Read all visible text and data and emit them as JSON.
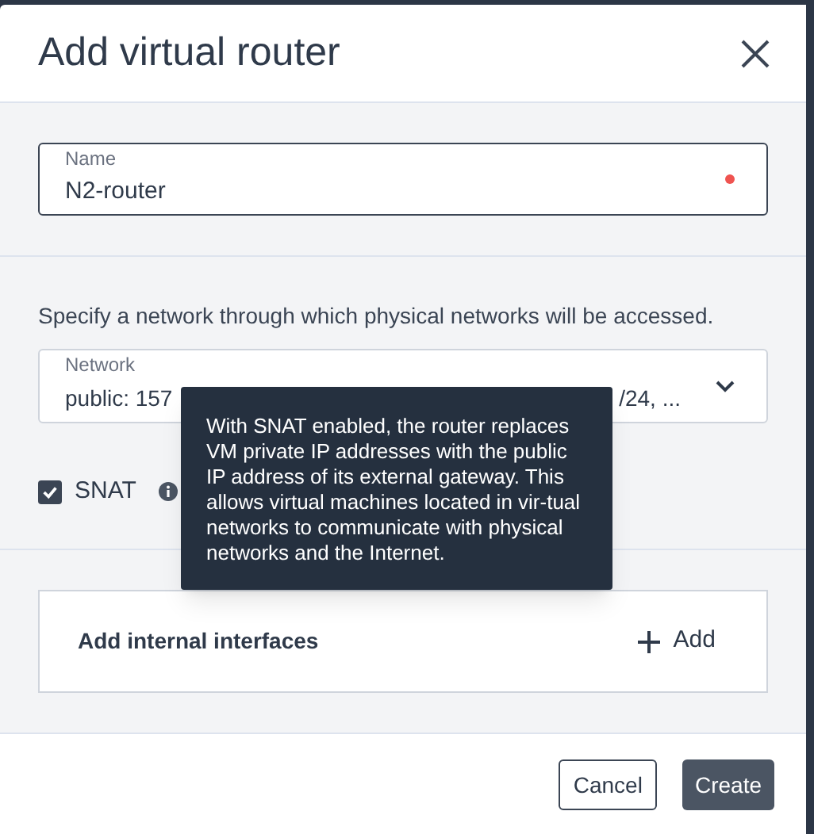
{
  "dialog": {
    "title": "Add virtual router"
  },
  "name_field": {
    "label": "Name",
    "value": "N2-router",
    "required": true
  },
  "network_section": {
    "description": "Specify a network through which physical networks will be accessed.",
    "field": {
      "label": "Network",
      "value_start": "public: 157",
      "value_end": "/24, ..."
    },
    "snat": {
      "label": "SNAT",
      "checked": true
    }
  },
  "tooltip": {
    "text": "With SNAT enabled, the router replaces VM private IP addresses with the public IP address of its external gateway. This allows virtual machines located in vir-tual networks to communicate with physical networks and the Internet."
  },
  "interfaces": {
    "label": "Add internal interfaces",
    "add_button": "Add"
  },
  "buttons": [
    {
      "label": "Cancel",
      "kind": "secondary"
    },
    {
      "label": "Create",
      "kind": "primary"
    }
  ]
}
